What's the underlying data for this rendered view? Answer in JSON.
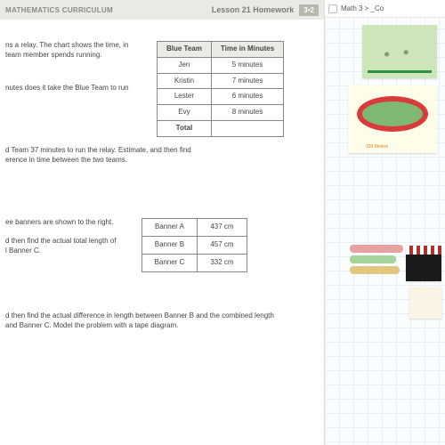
{
  "header": {
    "curriculum": "MATHEMATICS CURRICULUM",
    "lesson": "Lesson 21 Homework",
    "badge": "3•2"
  },
  "q1": {
    "intro1": "ns a relay.  The chart shows the time, in",
    "intro2": " team member spends running.",
    "sub_a": "nutes does it take the Blue Team to run",
    "table": {
      "head1": "Blue Team",
      "head2": "Time in Minutes",
      "rows": [
        {
          "name": "Jen",
          "time": "5 minutes"
        },
        {
          "name": "Kristin",
          "time": "7 minutes"
        },
        {
          "name": "Lester",
          "time": "6 minutes"
        },
        {
          "name": "Evy",
          "time": "8 minutes"
        }
      ],
      "total": "Total"
    }
  },
  "q2": {
    "l1": "d Team 37 minutes to run the relay.  Estimate, and then find",
    "l2": "erence in time between the two teams."
  },
  "q3": {
    "l1": "ee banners are shown to the right.",
    "l2": "d then find the actual total length of",
    "l3": "l Banner C.",
    "rows": [
      {
        "label": "Banner A",
        "val": "437 cm"
      },
      {
        "label": "Banner B",
        "val": "457 cm"
      },
      {
        "label": "Banner C",
        "val": "332 cm"
      }
    ]
  },
  "q4": {
    "l1": "d then find the actual difference in length between Banner B and the combined length",
    "l2": "and Banner C.  Model the problem with a tape diagram."
  },
  "crumb": {
    "text": "Math 3 > _Co"
  },
  "track_label": "100 Meters"
}
